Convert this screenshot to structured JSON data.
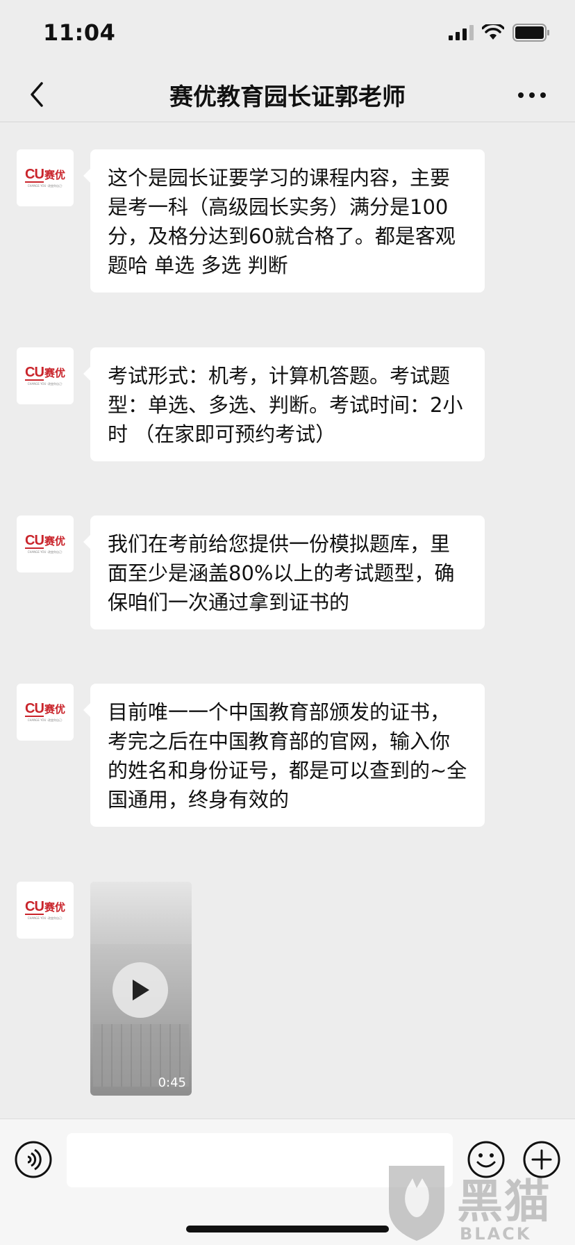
{
  "status_bar": {
    "time": "11:04"
  },
  "header": {
    "title": "赛优教育园长证郭老师"
  },
  "avatar": {
    "logo_letters": "CU",
    "logo_name": "赛优",
    "slogan": "CHANGE YOU ·改变你自己·"
  },
  "messages": [
    {
      "type": "text",
      "text": "这个是园长证要学习的课程内容，主要是考一科（高级园长实务）满分是100分，及格分达到60就合格了。都是客观题哈 单选  多选  判断"
    },
    {
      "type": "text",
      "text": "考试形式：机考，计算机答题。考试题型：单选、多选、判断。考试时间：2小时  （在家即可预约考试）"
    },
    {
      "type": "text",
      "text": "我们在考前给您提供一份模拟题库，里面至少是涵盖80%以上的考试题型，确保咱们一次通过拿到证书的"
    },
    {
      "type": "text",
      "text": "目前唯一一个中国教育部颁发的证书，考完之后在中国教育部的官网，输入你的姓名和身份证号，都是可以查到的~全国通用，终身有效的"
    },
    {
      "type": "video",
      "duration": "0:45"
    }
  ],
  "input_bar": {
    "placeholder": ""
  },
  "watermark": {
    "cn": "黑猫",
    "en": "BLACK CAT"
  }
}
